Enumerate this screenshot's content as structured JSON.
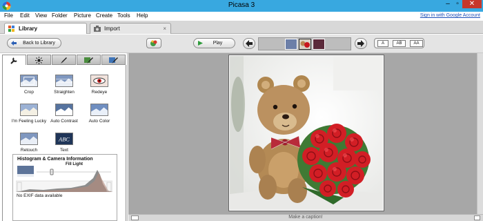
{
  "window": {
    "title": "Picasa 3"
  },
  "menu": {
    "items": [
      "File",
      "Edit",
      "View",
      "Folder",
      "Picture",
      "Create",
      "Tools",
      "Help"
    ],
    "signin_link": "Sign in with Google Account"
  },
  "tabs": [
    {
      "label": "Library"
    },
    {
      "label": "Import",
      "close": "×"
    }
  ],
  "toolbar": {
    "back_label": "Back to Library",
    "play_label": "Play",
    "text_sizes": [
      "A",
      "AB",
      "AA"
    ]
  },
  "edit_tabs": [
    "wrench-icon",
    "sun-icon",
    "brush-icon",
    "effects-brush-icon",
    "pen-brush-icon"
  ],
  "tools": [
    {
      "label": "Crop",
      "icon": "crop-icon"
    },
    {
      "label": "Straighten",
      "icon": "straighten-icon"
    },
    {
      "label": "Redeye",
      "icon": "redeye-icon"
    },
    {
      "label": "I'm Feeling Lucky",
      "icon": "feeling-lucky-icon"
    },
    {
      "label": "Auto Contrast",
      "icon": "auto-contrast-icon"
    },
    {
      "label": "Auto Color",
      "icon": "auto-color-icon"
    },
    {
      "label": "Retouch",
      "icon": "retouch-icon"
    },
    {
      "label": "Text",
      "icon": "text-icon",
      "badge": "ABC"
    }
  ],
  "histogram": {
    "title": "Histogram & Camera Information",
    "fill_light_label": "Fill Light",
    "exif_text": "No EXIF data available"
  },
  "caption": {
    "placeholder": "Make a caption!"
  },
  "colors": {
    "titlebar": "#38a8e0",
    "close": "#c7372b",
    "canvas": "#a7a7a7",
    "link": "#1c4fb8"
  }
}
